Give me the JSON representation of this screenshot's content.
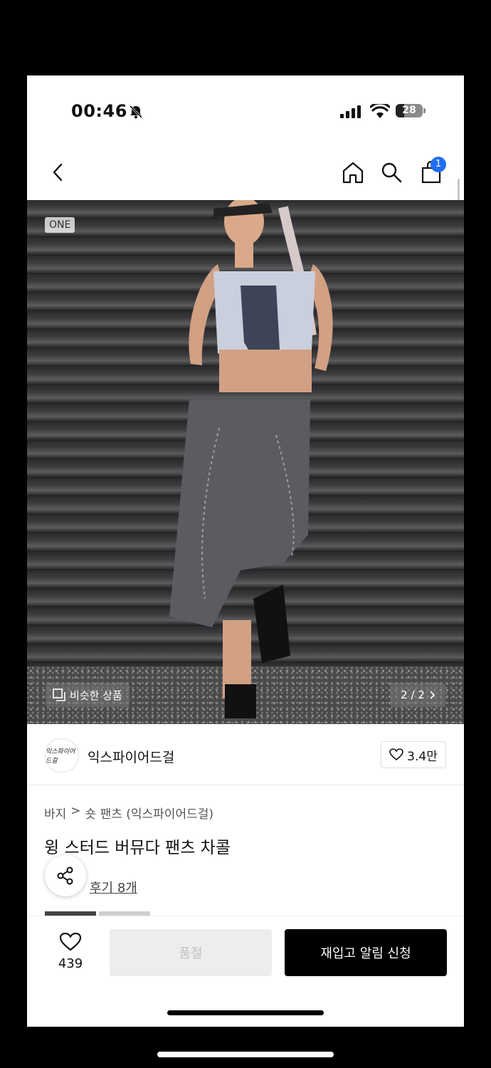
{
  "status_bar": {
    "time": "00:46",
    "battery": "28"
  },
  "nav": {
    "cart_count": "1"
  },
  "hero": {
    "badge": "ONE",
    "similar_label": "비슷한 상품",
    "pager": "2 / 2"
  },
  "seller": {
    "logo_text": "익스파이어드걸",
    "name": "익스파이어드걸",
    "likes": "3.4만"
  },
  "product": {
    "breadcrumb": [
      "바지",
      "숏 팬츠 (익스파이어드걸)"
    ],
    "title": "윙 스터드 버뮤다 팬츠 차콜",
    "review_link": "후기 8개"
  },
  "bottom_bar": {
    "wish_count": "439",
    "soldout_label": "품절",
    "restock_label": "재입고 알림 신청"
  },
  "colors": {
    "accent_blue": "#1e6ef0",
    "primary_black": "#000000"
  }
}
